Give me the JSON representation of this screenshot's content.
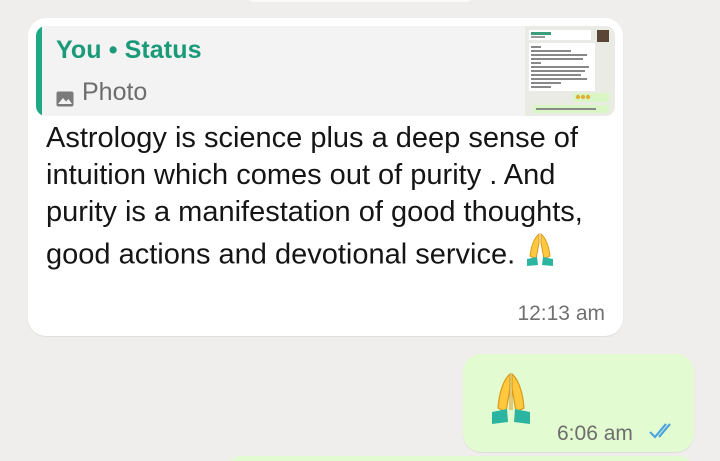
{
  "incoming": {
    "reply": {
      "title": "You • Status",
      "media_label": "Photo",
      "accent_color": "#1fa884",
      "icon": "photo-icon"
    },
    "text": "Astrology is science plus a deep sense of intuition which comes out of purity . And purity is a manifestation of good thoughts, good actions and devotional service.",
    "emoji": "folded-hands-icon",
    "time": "12:13 am"
  },
  "outgoing": {
    "emoji": "folded-hands-icon",
    "time": "6:06 am",
    "status_icon": "double-check-icon",
    "status_color": "#4fa4de"
  },
  "colors": {
    "background": "#efeeec",
    "incoming_bubble": "#ffffff",
    "outgoing_bubble": "#e3fbd1"
  }
}
